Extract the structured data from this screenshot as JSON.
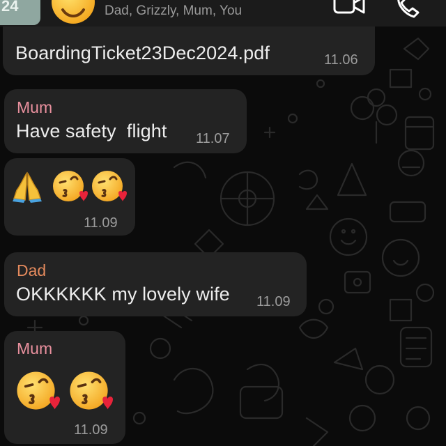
{
  "header": {
    "group_avatar_text": "24",
    "participants": "Dad, Grizzly, Mum, You",
    "icons": [
      "group-avatar",
      "smiling-face-emoji",
      "video-call-icon",
      "phone-call-icon"
    ]
  },
  "messages": [
    {
      "type": "document",
      "filename": "BoardingTicket23Dec2024.pdf",
      "time": "11.06"
    },
    {
      "sender": "Mum",
      "text": "Have safety  flight",
      "time": "11.07"
    },
    {
      "emojis": [
        "folded-hands",
        "face-blowing-a-kiss",
        "face-blowing-a-kiss"
      ],
      "time": "11.09"
    },
    {
      "sender": "Dad",
      "text": "OKKKKKK my lovely wife",
      "time": "11.09"
    },
    {
      "sender": "Mum",
      "emojis": [
        "face-blowing-a-kiss",
        "face-blowing-a-kiss"
      ],
      "time": "11.09"
    }
  ],
  "colors": {
    "background": "#0b0b0b",
    "header": "#1b1b1b",
    "bubble": "#232323",
    "mum_name": "#e9909e",
    "dad_name": "#e48a5d",
    "message_text": "#ededed",
    "timestamp": "#9c9c9c"
  }
}
